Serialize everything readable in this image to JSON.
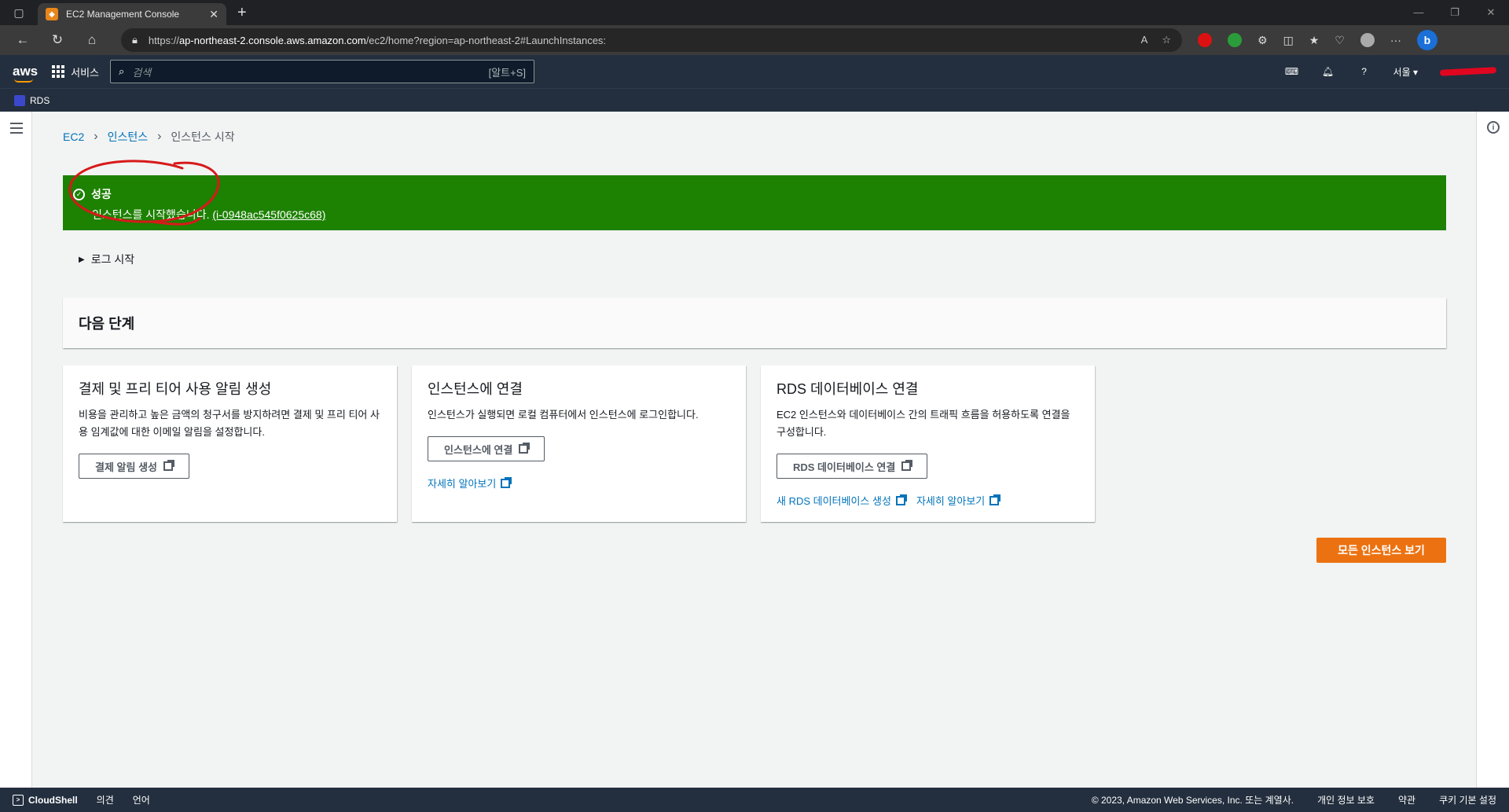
{
  "browser": {
    "tab_title": "EC2 Management Console",
    "url_prefix": "https://",
    "url_host": "ap-northeast-2.console.aws.amazon.com",
    "url_path": "/ec2/home?region=ap-northeast-2#LaunchInstances:"
  },
  "aws_header": {
    "logo": "aws",
    "services_label": "서비스",
    "search_placeholder": "검색",
    "search_shortcut": "[알트+S]",
    "region": "서울 ▾"
  },
  "favorites": {
    "rds": "RDS"
  },
  "breadcrumb": {
    "ec2": "EC2",
    "instances": "인스턴스",
    "current": "인스턴스 시작"
  },
  "flash": {
    "title": "성공",
    "message": "인스턴스를 시작했습니다. ",
    "instance_id": "(i-0948ac545f0625c68)",
    "color": "#1d8102"
  },
  "log_toggle": "로그 시작",
  "next_steps_title": "다음 단계",
  "cards": [
    {
      "title": "결제 및 프리 티어 사용 알림 생성",
      "desc": "비용을 관리하고 높은 금액의 청구서를 방지하려면 결제 및 프리 티어 사용 임계값에 대한 이메일 알림을 설정합니다.",
      "button": "결제 알림 생성"
    },
    {
      "title": "인스턴스에 연결",
      "desc": "인스턴스가 실행되면 로컬 컴퓨터에서 인스턴스에 로그인합니다.",
      "button": "인스턴스에 연결",
      "link1": "자세히 알아보기"
    },
    {
      "title": "RDS 데이터베이스 연결",
      "desc": "EC2 인스턴스와 데이터베이스 간의 트래픽 흐름을 허용하도록 연결을 구성합니다.",
      "button": "RDS 데이터베이스 연결",
      "link1": "새 RDS 데이터베이스 생성",
      "link2": "자세히 알아보기"
    }
  ],
  "view_all_button": "모든 인스턴스 보기",
  "footer": {
    "cloudshell": "CloudShell",
    "feedback": "의견",
    "language": "언어",
    "copyright": "© 2023, Amazon Web Services, Inc. 또는 계열사.",
    "privacy": "개인 정보 보호",
    "terms": "약관",
    "cookies": "쿠키 기본 설정"
  },
  "colors": {
    "aws_nav": "#232f3e",
    "primary_button": "#ec7211",
    "link": "#0073bb"
  }
}
